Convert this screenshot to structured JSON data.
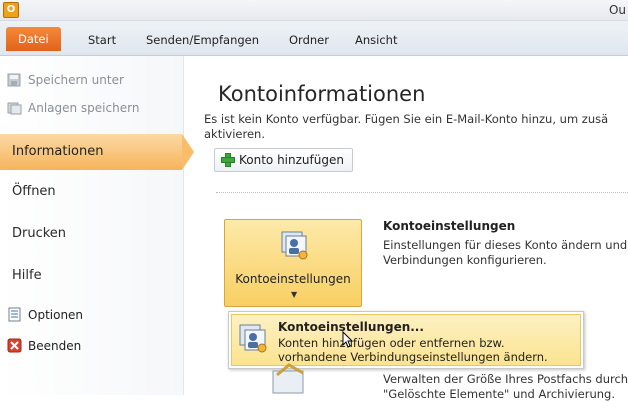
{
  "window": {
    "title": "Ou",
    "app_icon_letter": "O"
  },
  "ribbon": {
    "tabs": [
      {
        "label": "Datei"
      },
      {
        "label": "Start"
      },
      {
        "label": "Senden/Empfangen"
      },
      {
        "label": "Ordner"
      },
      {
        "label": "Ansicht"
      }
    ]
  },
  "nav": {
    "save_as": "Speichern unter",
    "save_attachments": "Anlagen speichern",
    "info": "Informationen",
    "open": "Öffnen",
    "print": "Drucken",
    "help": "Hilfe",
    "options": "Optionen",
    "exit": "Beenden"
  },
  "main": {
    "title": "Kontoinformationen",
    "desc_line1": "Es ist kein Konto verfügbar. Fügen Sie ein E-Mail-Konto hinzu, um zusä",
    "desc_line2": "aktivieren.",
    "add_account": "Konto hinzufügen",
    "account_settings_button": "Kontoeinstellungen",
    "section_title": "Kontoeinstellungen",
    "section_desc_line1": "Einstellungen für dieses Konto ändern und",
    "section_desc_line2": "Verbindungen konfigurieren.",
    "cleanup_line1": "Verwalten der Größe Ihres Postfachs durch",
    "cleanup_line2": "\"Gelöschte Elemente\" und Archivierung."
  },
  "popup": {
    "title": "Kontoeinstellungen...",
    "desc_line1": "Konten hinzufügen oder entfernen bzw.",
    "desc_line2": "vorhandene Verbindungseinstellungen ändern."
  }
}
